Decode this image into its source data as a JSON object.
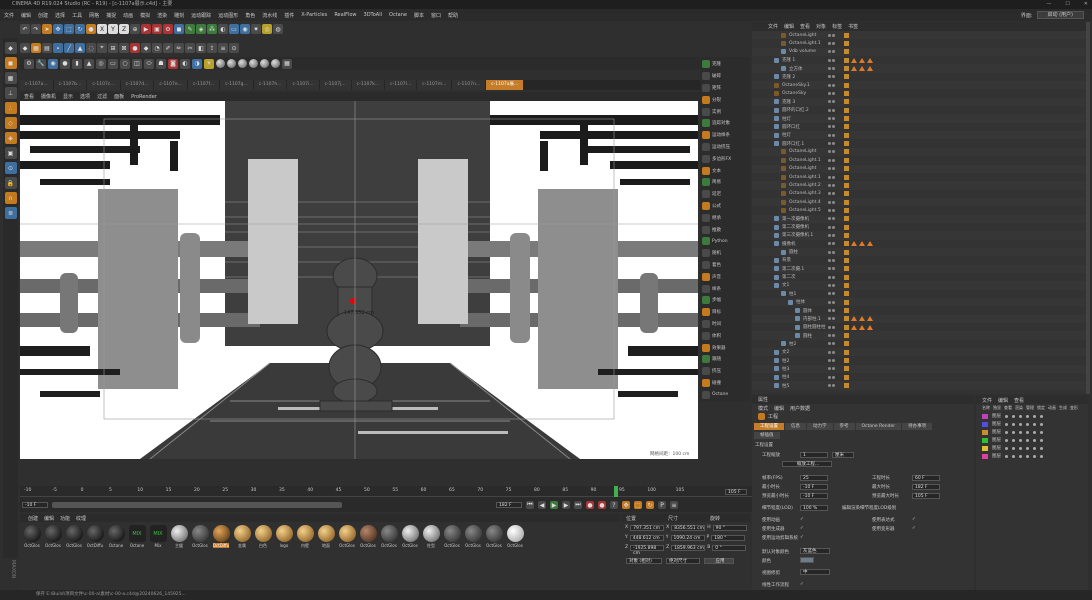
{
  "window": {
    "title": "CINEMA 4D R19.024 Studio (RC - R19) - [c-1107a展示.c4d] - 主要",
    "controls": [
      "—",
      "☐",
      "✕"
    ]
  },
  "menu": {
    "items": [
      "文件",
      "编辑",
      "创建",
      "选择",
      "工具",
      "网格",
      "捕捉",
      "动画",
      "模拟",
      "渲染",
      "雕刻",
      "运动跟踪",
      "运动图形",
      "角色",
      "流水线",
      "插件",
      "X-Particles",
      "RealFlow",
      "3DToAll",
      "Octane",
      "脚本",
      "窗口",
      "帮助"
    ],
    "layout_label": "界面:",
    "layout_value": "启动 (用户)"
  },
  "toolbar": {
    "axis": [
      "X",
      "Y",
      "Z"
    ]
  },
  "tabs": [
    "c-1107a...",
    "c-1107b...",
    "c-1107c...",
    "c-1107d...",
    "c-1107e...",
    "c-1107f...",
    "c-1107g...",
    "c-1107h...",
    "c-1107i...",
    "c-1107j...",
    "c-1107k...",
    "c-1107l...",
    "c-1107m...",
    "c-1107n...",
    "c-1107a展..."
  ],
  "viewport": {
    "menu": [
      "查看",
      "摄像机",
      "显示",
      "选项",
      "过滤",
      "面板",
      "ProRender"
    ],
    "measure_label": "147.352 cm",
    "corner_label": "网格间距：100 cm"
  },
  "right_tools": [
    "克隆",
    "破碎",
    "矩阵",
    "分裂",
    "实例",
    "追踪对象",
    "运动样条",
    "运动挤压",
    "多边形FX",
    "文本",
    "简易",
    "延迟",
    "公式",
    "继承",
    "推散",
    "Python",
    "随机",
    "着色",
    "声音",
    "样条",
    "步幅",
    "目标",
    "时间",
    "体积",
    "效果器",
    "跟随",
    "挤压",
    "碰撞",
    "Octane"
  ],
  "objects": {
    "menu": [
      "文件",
      "编辑",
      "查看",
      "对象",
      "标签",
      "书签"
    ],
    "rows": [
      {
        "name": "OctaneLight",
        "indent": 1
      },
      {
        "name": "OctaneLight.1",
        "indent": 1
      },
      {
        "name": "Vdb volume",
        "indent": 1
      },
      {
        "name": "克隆 1",
        "indent": 0
      },
      {
        "name": "立方体",
        "indent": 1
      },
      {
        "name": "克隆 2",
        "indent": 0
      },
      {
        "name": "OctaneSky.1",
        "indent": 0
      },
      {
        "name": "OctaneSky",
        "indent": 0
      },
      {
        "name": "克隆 3",
        "indent": 0
      },
      {
        "name": "圆环的口红.2",
        "indent": 0
      },
      {
        "name": "柱灯",
        "indent": 0
      },
      {
        "name": "圆环口红",
        "indent": 0
      },
      {
        "name": "柱灯",
        "indent": 0
      },
      {
        "name": "圆环口红.1",
        "indent": 0
      },
      {
        "name": "OctaneLight",
        "indent": 1
      },
      {
        "name": "OctaneLight.1",
        "indent": 1
      },
      {
        "name": "OctaneLight",
        "indent": 1
      },
      {
        "name": "OctaneLight.1",
        "indent": 1
      },
      {
        "name": "OctaneLight.2",
        "indent": 1
      },
      {
        "name": "OctaneLight.3",
        "indent": 1
      },
      {
        "name": "OctaneLight.4",
        "indent": 1
      },
      {
        "name": "OctaneLight.5",
        "indent": 1
      },
      {
        "name": "第一次摄像机",
        "indent": 0
      },
      {
        "name": "第二次摄像机",
        "indent": 0
      },
      {
        "name": "第三次摄像机.1",
        "indent": 0
      },
      {
        "name": "摄像机",
        "indent": 0
      },
      {
        "name": "圆柱",
        "indent": 1
      },
      {
        "name": "背景",
        "indent": 0
      },
      {
        "name": "第二次摄.1",
        "indent": 0
      },
      {
        "name": "第二次",
        "indent": 0
      },
      {
        "name": "文1",
        "indent": 0
      },
      {
        "name": "柱1",
        "indent": 1
      },
      {
        "name": "柱体",
        "indent": 2
      },
      {
        "name": "圆体",
        "indent": 3
      },
      {
        "name": "内部柱.1",
        "indent": 3
      },
      {
        "name": "圆柱圆柱柱",
        "indent": 3
      },
      {
        "name": "圆柱",
        "indent": 3
      },
      {
        "name": "柱2",
        "indent": 1
      },
      {
        "name": "文2",
        "indent": 0
      },
      {
        "name": "柱2",
        "indent": 0
      },
      {
        "name": "柱3",
        "indent": 0
      },
      {
        "name": "柱4",
        "indent": 0
      },
      {
        "name": "柱5",
        "indent": 0
      }
    ]
  },
  "attributes": {
    "header": "属性",
    "menu": [
      "模式",
      "编辑",
      "用户数据"
    ],
    "object_name": "工程",
    "tabs": [
      "工程设置",
      "信息",
      "动力学",
      "参考",
      "Octane Render",
      "待办事项",
      "帧插值"
    ],
    "section": "工程设置",
    "fields": [
      {
        "label": "工程缩放",
        "value": "1",
        "unit": "厘米"
      },
      {
        "label": "帧率(FPS)",
        "value": "25"
      },
      {
        "label": "工程时长",
        "value": "60 F"
      },
      {
        "label": "最小时长",
        "value": "-10 F"
      },
      {
        "label": "最大时长",
        "value": "182 F"
      },
      {
        "label": "预览最小时长",
        "value": "-10 F"
      },
      {
        "label": "预览最大时长",
        "value": "105 F"
      },
      {
        "label": "细节程度(LOD)",
        "value": "100 %"
      },
      {
        "label": "使用动画",
        "value": "✓"
      },
      {
        "label": "使用表达式",
        "value": "✓"
      },
      {
        "label": "使用生成器",
        "value": "✓"
      },
      {
        "label": "使用变形器",
        "value": "✓"
      },
      {
        "label": "使用运动剪辑系统",
        "value": "✓"
      }
    ],
    "scale_button": "缩放工程...",
    "lod_note": "编辑渲染细节程度LOD级别",
    "default_color_label": "默认对象颜色",
    "default_color_value": "灰蓝色",
    "color_label": "颜色",
    "view_clip_label": "视图修剪",
    "view_clip_value": "中",
    "linear_label": "线性工作流程",
    "linear_value": "✓"
  },
  "layers": {
    "menu": [
      "文件",
      "编辑",
      "查看"
    ],
    "columns": [
      "名称",
      "独显",
      "查看",
      "渲染",
      "管理",
      "锁定",
      "动画",
      "生成",
      "变形"
    ],
    "rows": [
      {
        "name": "图层",
        "color": "#c040c0"
      },
      {
        "name": "图层",
        "color": "#5050e0"
      },
      {
        "name": "图层",
        "color": "#d08a30"
      },
      {
        "name": "图层",
        "color": "#30c030"
      },
      {
        "name": "图层",
        "color": "#e0c030"
      },
      {
        "name": "图层",
        "color": "#e040a0"
      }
    ]
  },
  "timeline": {
    "ticks": [
      "-10",
      "-5",
      "0",
      "5",
      "10",
      "15",
      "20",
      "25",
      "30",
      "35",
      "40",
      "45",
      "50",
      "55",
      "60",
      "65",
      "70",
      "75",
      "80",
      "85",
      "90",
      "95",
      "100",
      "105"
    ],
    "start": "-10 F",
    "end_display": "182 F",
    "current": "90 F",
    "frame_end": "105 F"
  },
  "materials": {
    "menu": [
      "创建",
      "编辑",
      "功能",
      "纹理"
    ],
    "items": [
      {
        "name": "OctGlos",
        "type": "black"
      },
      {
        "name": "OctGlos",
        "type": "black"
      },
      {
        "name": "OctGlos",
        "type": "black"
      },
      {
        "name": "OctDiffu",
        "type": "black"
      },
      {
        "name": "Octane",
        "type": "black"
      },
      {
        "name": "Octane",
        "type": "mix",
        "label": "MIX"
      },
      {
        "name": "Mix",
        "type": "mix",
        "label": "MIX"
      },
      {
        "name": "主缓",
        "type": "gray"
      },
      {
        "name": "OctGlos",
        "type": "dark"
      },
      {
        "name": "OctDiffu",
        "type": "bronze"
      },
      {
        "name": "金属",
        "type": "gold"
      },
      {
        "name": "白色",
        "type": "gold"
      },
      {
        "name": "logo",
        "type": "gold"
      },
      {
        "name": "内壁",
        "type": "gold"
      },
      {
        "name": "地面",
        "type": "gold"
      },
      {
        "name": "OctGlos",
        "type": "gold"
      },
      {
        "name": "OctGlos",
        "type": "brown"
      },
      {
        "name": "OctGlos",
        "type": "dark"
      },
      {
        "name": "OctGlos",
        "type": "gray"
      },
      {
        "name": "柱型",
        "type": "gray"
      },
      {
        "name": "OctGlos",
        "type": "dark"
      },
      {
        "name": "OctGlos",
        "type": "dark"
      },
      {
        "name": "OctGlos",
        "type": "dark"
      },
      {
        "name": "OctGlos",
        "type": "white"
      }
    ]
  },
  "coordinates": {
    "headers": [
      "位置",
      "尺寸",
      "旋转"
    ],
    "rows": [
      {
        "axis": "X",
        "pos": "797.351 cm",
        "size": "8356.551 cm",
        "rot_axis": "H",
        "rot": "90 °"
      },
      {
        "axis": "Y",
        "pos": "448.612 cm",
        "size": "1090.24 cm",
        "rot_axis": "P",
        "rot": "180 °"
      },
      {
        "axis": "Z",
        "pos": "-1925.898 cm",
        "size": "1859.963 cm",
        "rot_axis": "B",
        "rot": "0 °"
      }
    ],
    "mode_a": "对象 (相对)",
    "mode_b": "绝对尺寸",
    "apply": "应用"
  },
  "status": {
    "text": "保存 E:\\Build\\项目文件\\c-00-a\\素材\\c-00-a.c4d@20240626_145925..."
  },
  "colors": {
    "accent": "#c57d2a",
    "panel": "#333333",
    "viewport_bg": "#ffffff"
  }
}
